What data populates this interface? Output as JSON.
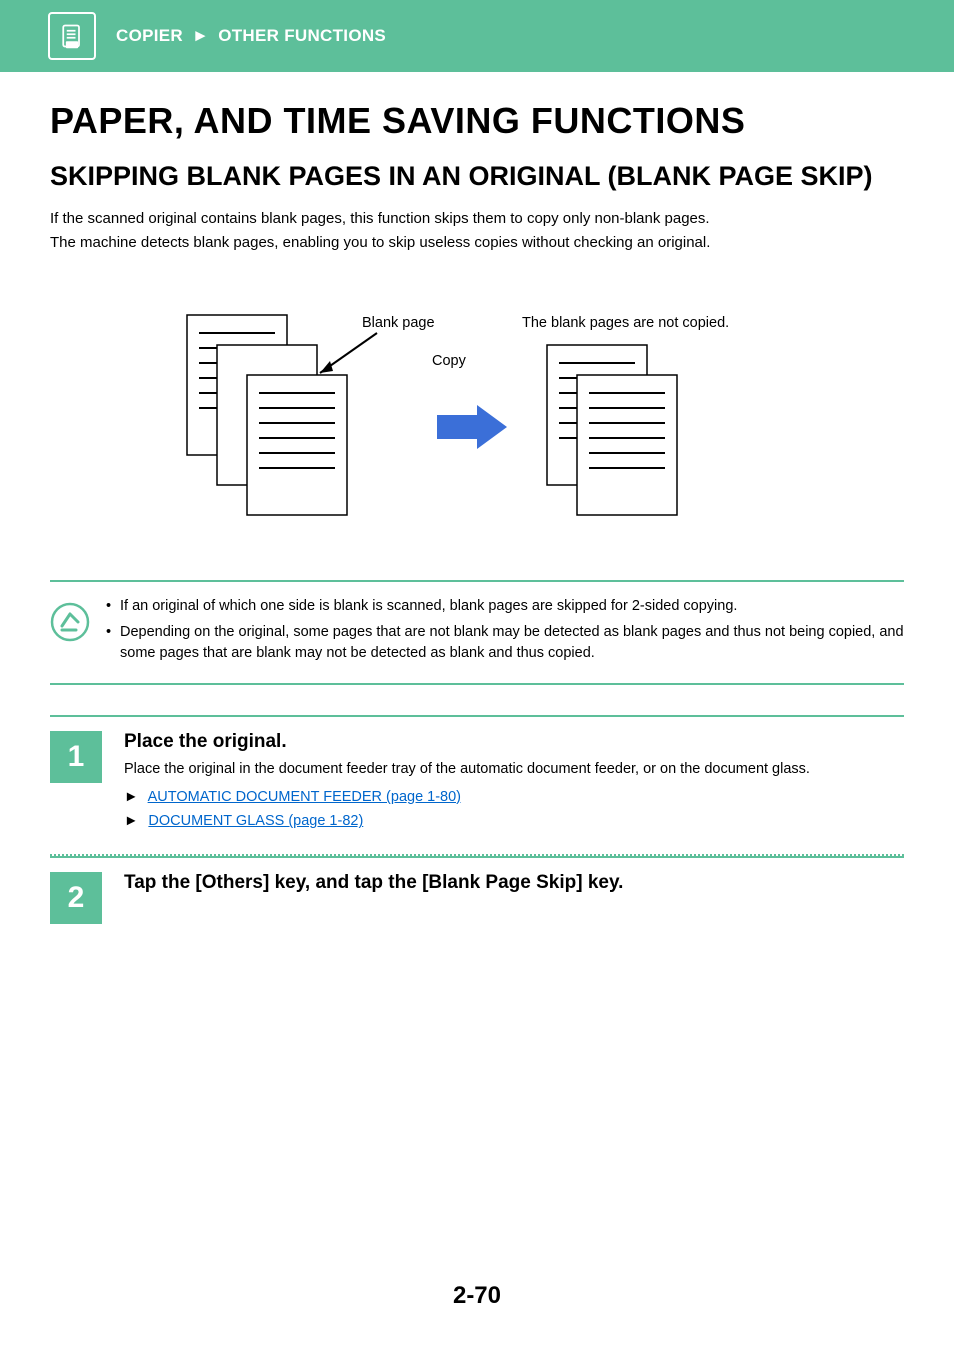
{
  "header": {
    "breadcrumb_section": "COPIER",
    "breadcrumb_page": "OTHER FUNCTIONS"
  },
  "main": {
    "h1": "PAPER, AND TIME SAVING FUNCTIONS",
    "h2": "SKIPPING BLANK PAGES IN AN ORIGINAL (BLANK PAGE SKIP)",
    "intro_lines": [
      "If the scanned original contains blank pages, this function skips them to copy only non-blank pages.",
      "The machine detects blank pages, enabling you to skip useless copies without checking an original."
    ],
    "diagram": {
      "label_blank_page": "Blank page",
      "label_copy": "Copy",
      "label_result": "The blank pages are not copied."
    },
    "notes": [
      "If an original of which one side is blank is scanned, blank pages are skipped for 2-sided copying.",
      "Depending on the original, some pages that are not blank may be detected as blank pages and thus not being copied, and some pages that are blank may not be detected as blank and thus copied."
    ],
    "steps": [
      {
        "num": "1",
        "title": "Place the original.",
        "desc": "Place the original in the document feeder tray of the automatic document feeder, or on the document glass.",
        "links": [
          "AUTOMATIC DOCUMENT FEEDER (page 1-80)",
          "DOCUMENT GLASS (page 1-82)"
        ]
      },
      {
        "num": "2",
        "title": "Tap the [Others] key, and tap the [Blank Page Skip] key.",
        "desc": "",
        "links": []
      }
    ]
  },
  "page_number": "2-70"
}
